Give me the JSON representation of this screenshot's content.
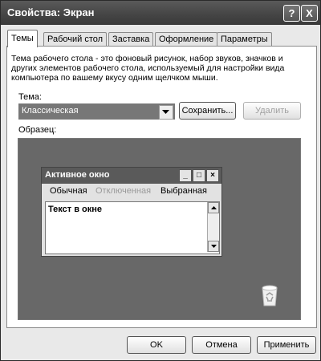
{
  "window": {
    "title": "Свойства: Экран"
  },
  "titlebar": {
    "help": "?",
    "close": "X"
  },
  "tabs": [
    "Темы",
    "Рабочий стол",
    "Заставка",
    "Оформление",
    "Параметры"
  ],
  "themes": {
    "description": "Тема рабочего стола - это фоновый рисунок, набор звуков, значков и других элементов рабочего стола, используемый для настройки вида компьютера по вашему вкусу одним щелчком мыши.",
    "theme_label": "Тема:",
    "theme_value": "Классическая",
    "save_label": "Сохранить...",
    "delete_label": "Удалить",
    "sample_label": "Образец:"
  },
  "preview": {
    "window_title": "Активное окно",
    "menu_normal": "Обычная",
    "menu_disabled": "Отключенная",
    "menu_selected": "Выбранная",
    "window_text": "Текст в окне"
  },
  "buttons": {
    "ok": "OK",
    "cancel": "Отмена",
    "apply": "Применить"
  },
  "icons": {
    "help": "help-icon",
    "close": "close-icon",
    "dropdown": "chevron-down-icon",
    "recycle_bin": "recycle-bin-icon"
  }
}
